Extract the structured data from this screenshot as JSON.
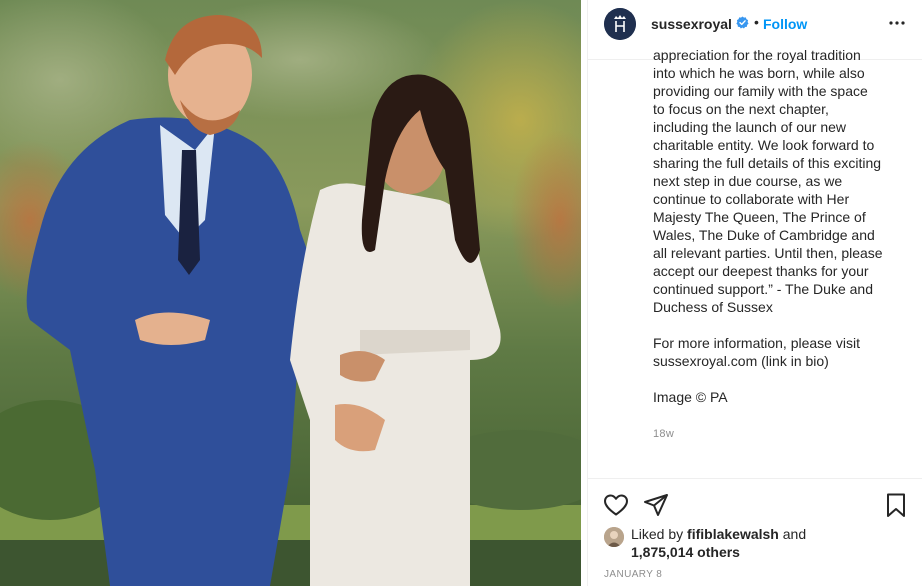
{
  "post": {
    "username": "sussexroyal",
    "separator": "•",
    "follow_label": "Follow",
    "caption_lines": [
      "appreciation for the royal tradition",
      "into which he was born, while also",
      "providing our family with the space",
      "to focus on the next chapter,",
      "including the launch of our new",
      "charitable entity. We look forward to",
      "sharing the full details of this exciting",
      "next step in due course, as we",
      "continue to collaborate with Her",
      "Majesty The Queen, The Prince of",
      "Wales, The Duke of Cambridge and",
      "all relevant parties. Until then, please",
      "accept our deepest thanks for your",
      "continued support.” - The Duke and",
      "Duchess of Sussex"
    ],
    "info_lines": [
      "For more information, please visit",
      "sussexroyal.com (link in bio)"
    ],
    "credit": "Image © PA",
    "time_ago": "18w",
    "liked_by_prefix": "Liked by",
    "liked_by_user": "fifiblakewalsh",
    "liked_by_suffix": "and",
    "others_count": "1,875,014 others",
    "date": "JANUARY 8"
  },
  "icons": {
    "verified": "verified-badge-icon",
    "more": "more-options-icon",
    "like": "heart-icon",
    "share": "paper-plane-icon",
    "save": "bookmark-icon"
  },
  "colors": {
    "follow": "#0095f6",
    "verified": "#3897f0",
    "muted": "#8e8e8e",
    "text": "#262626"
  }
}
